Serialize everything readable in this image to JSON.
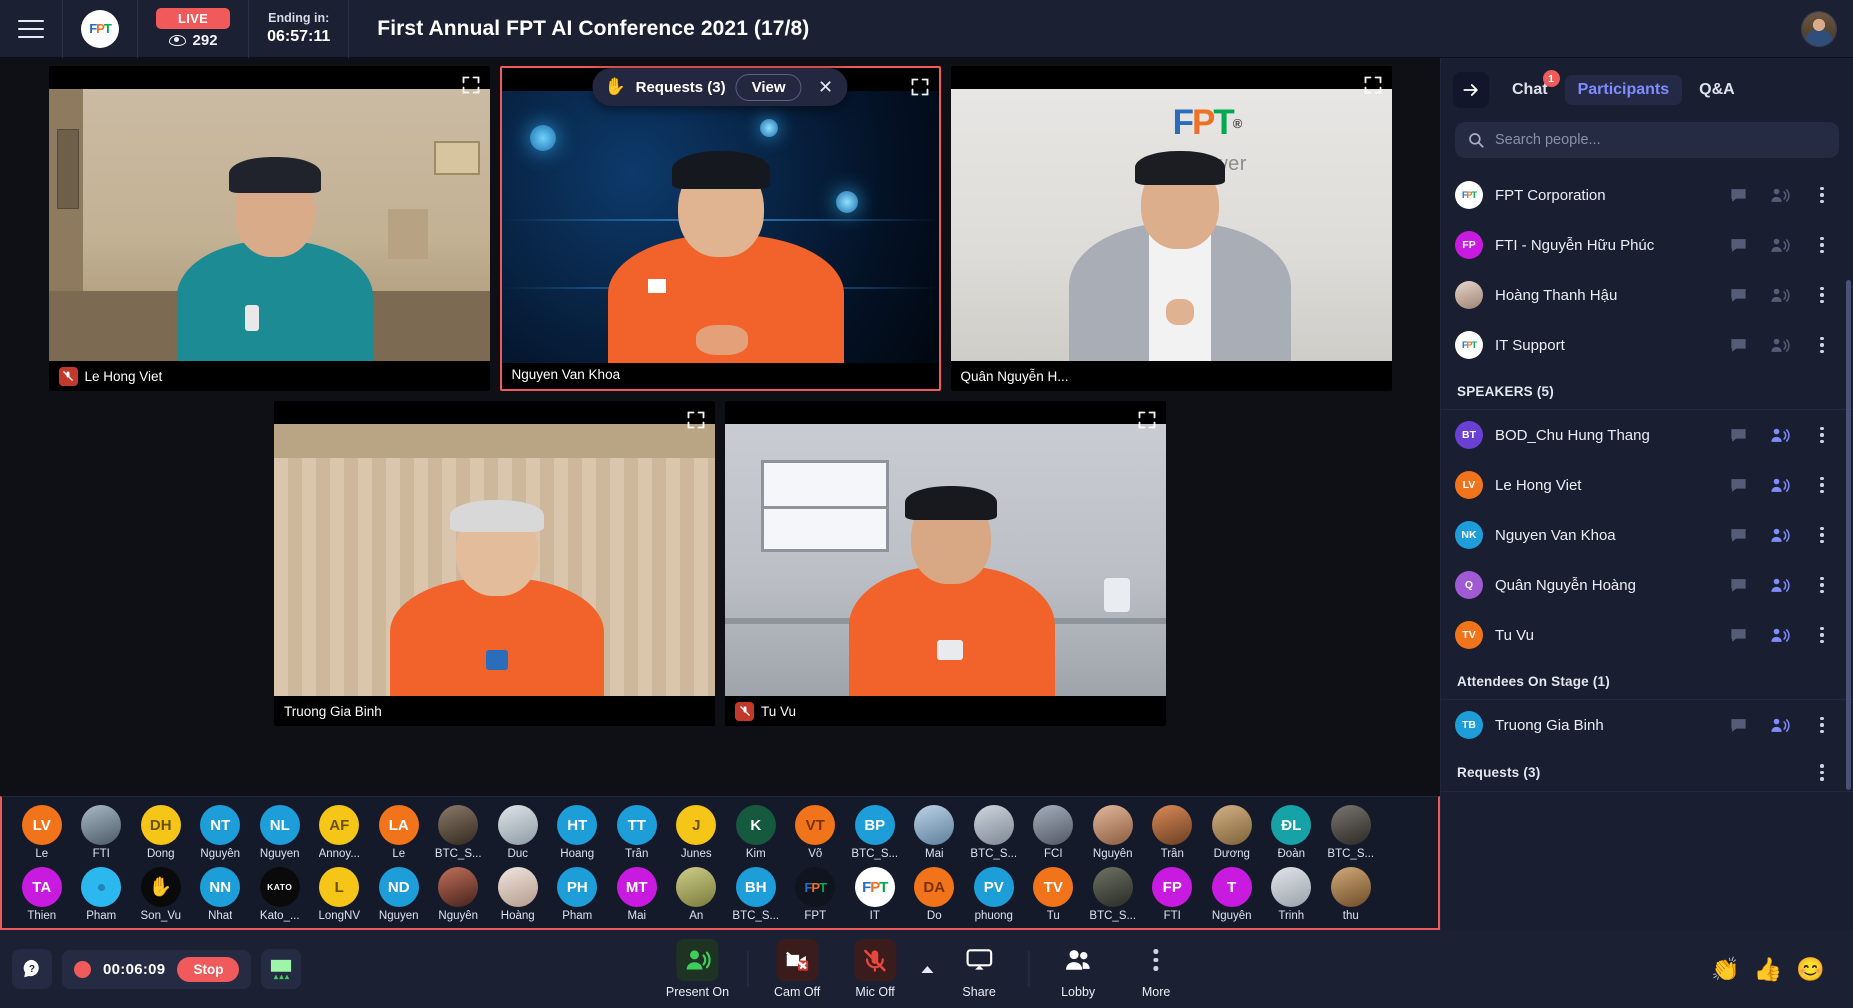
{
  "topbar": {
    "menu_icon": "hamburger-icon",
    "brand": "FPT",
    "live_label": "LIVE",
    "viewer_count": "292",
    "ending_label": "Ending in:",
    "ending_time": "06:57:11",
    "title": "First Annual FPT AI Conference 2021 (17/8)"
  },
  "requests_banner": {
    "hand_icon": "raised-hand-icon",
    "label": "Requests (3)",
    "view_label": "View",
    "close_label": "✕"
  },
  "tiles": [
    {
      "name": "Le Hong Viet",
      "muted": true,
      "bg": "office-teal"
    },
    {
      "name": "Nguyen Van Khoa",
      "muted": false,
      "bg": "tech-blue",
      "active": true
    },
    {
      "name": "Quân Nguyễn H...",
      "muted": false,
      "bg": "fpt-tower"
    },
    {
      "name": "Truong Gia Binh",
      "muted": false,
      "bg": "curtain-room"
    },
    {
      "name": "Tu Vu",
      "muted": true,
      "bg": "window-office"
    }
  ],
  "strip_row1": [
    {
      "initials": "LV",
      "name": "Le",
      "color": "#f2741a",
      "photo": false
    },
    {
      "initials": "",
      "name": "FTI",
      "color": "#5b7a94",
      "photo": true,
      "ph": "f1"
    },
    {
      "initials": "DH",
      "name": "Dong",
      "color": "#f5c518",
      "photo": false,
      "dark": true
    },
    {
      "initials": "NT",
      "name": "Nguyễn",
      "color": "#1e9ed9",
      "photo": false
    },
    {
      "initials": "NL",
      "name": "Nguyen",
      "color": "#1e9ed9",
      "photo": false
    },
    {
      "initials": "AF",
      "name": "Annoy...",
      "color": "#f5c518",
      "photo": false,
      "dark": true
    },
    {
      "initials": "LA",
      "name": "Le",
      "color": "#f2741a",
      "photo": false
    },
    {
      "initials": "",
      "name": "BTC_S...",
      "color": "#6b5a4a",
      "photo": true,
      "ph": "f2"
    },
    {
      "initials": "",
      "name": "Duc",
      "color": "#b9c3cc",
      "photo": true,
      "ph": "f3"
    },
    {
      "initials": "HT",
      "name": "Hoang",
      "color": "#1e9ed9",
      "photo": false
    },
    {
      "initials": "TT",
      "name": "Trần",
      "color": "#1e9ed9",
      "photo": false
    },
    {
      "initials": "J",
      "name": "Junes",
      "color": "#f5c518",
      "photo": false,
      "dark": true
    },
    {
      "initials": "K",
      "name": "Kim",
      "color": "#15593f",
      "photo": false
    },
    {
      "initials": "VT",
      "name": "Võ",
      "color": "#f2741a",
      "photo": false,
      "dark": true
    },
    {
      "initials": "BP",
      "name": "BTC_S...",
      "color": "#1e9ed9",
      "photo": false
    },
    {
      "initials": "",
      "name": "Mai",
      "color": "#88a7c2",
      "photo": true,
      "ph": "f4"
    },
    {
      "initials": "",
      "name": "BTC_S...",
      "color": "#9aa5b5",
      "photo": true,
      "ph": "f5"
    },
    {
      "initials": "",
      "name": "FCI",
      "color": "#8d98a8",
      "photo": true,
      "ph": "f6"
    },
    {
      "initials": "",
      "name": "Nguyễn",
      "color": "#c59a7a",
      "photo": true,
      "ph": "f7"
    },
    {
      "initials": "",
      "name": "Trần",
      "color": "#c4734a",
      "photo": true,
      "ph": "f8"
    },
    {
      "initials": "",
      "name": "Dương",
      "color": "#b8864f",
      "photo": true,
      "ph": "f9"
    },
    {
      "initials": "ĐL",
      "name": "Đoàn",
      "color": "#17a2a8",
      "photo": false
    },
    {
      "initials": "",
      "name": "BTC_S...",
      "color": "#6e6a66",
      "photo": true,
      "ph": "f10"
    }
  ],
  "strip_row2": [
    {
      "initials": "TA",
      "name": "Thien",
      "color": "#c91ae0",
      "photo": false
    },
    {
      "initials": "",
      "name": "Pham",
      "color": "#2bb8ef",
      "photo": false,
      "blank": true
    },
    {
      "initials": "✋",
      "name": "Son_Vu",
      "color": "#0a0a0a",
      "photo": false,
      "emoji": true
    },
    {
      "initials": "NN",
      "name": "Nhat",
      "color": "#1e9ed9",
      "photo": false
    },
    {
      "initials": "KATO",
      "name": "Kato_...",
      "color": "#0a0a0a",
      "photo": false,
      "tiny": true
    },
    {
      "initials": "L",
      "name": "LongNV",
      "color": "#f5c518",
      "photo": false,
      "dark": true
    },
    {
      "initials": "ND",
      "name": "Nguyen",
      "color": "#1e9ed9",
      "photo": false
    },
    {
      "initials": "",
      "name": "Nguyễn",
      "color": "#8a4a3a",
      "photo": true,
      "ph": "f11"
    },
    {
      "initials": "",
      "name": "Hoàng",
      "color": "#e0d7d2",
      "photo": true,
      "ph": "f12"
    },
    {
      "initials": "PH",
      "name": "Pham",
      "color": "#1e9ed9",
      "photo": false
    },
    {
      "initials": "MT",
      "name": "Mai",
      "color": "#c91ae0",
      "photo": false
    },
    {
      "initials": "",
      "name": "An",
      "color": "#b3b36a",
      "photo": true,
      "ph": "f13"
    },
    {
      "initials": "BH",
      "name": "BTC_S...",
      "color": "#1e9ed9",
      "photo": false
    },
    {
      "initials": "FPT",
      "name": "FPT",
      "color": "#111522",
      "photo": false,
      "logo": true
    },
    {
      "initials": "FPT",
      "name": "IT",
      "color": "#ffffff",
      "photo": false,
      "logo2": true
    },
    {
      "initials": "DA",
      "name": "Do",
      "color": "#f2741a",
      "photo": false,
      "dark": true
    },
    {
      "initials": "PV",
      "name": "phuong",
      "color": "#1e9ed9",
      "photo": false
    },
    {
      "initials": "TV",
      "name": "Tu",
      "color": "#f2741a",
      "photo": false
    },
    {
      "initials": "",
      "name": "BTC_S...",
      "color": "#5a5f52",
      "photo": true,
      "ph": "f14"
    },
    {
      "initials": "FP",
      "name": "FTI",
      "color": "#c91ae0",
      "photo": false
    },
    {
      "initials": "T",
      "name": "Nguyễn",
      "color": "#c91ae0",
      "photo": false
    },
    {
      "initials": "",
      "name": "Trinh",
      "color": "#d5d8dd",
      "photo": true,
      "ph": "f15"
    },
    {
      "initials": "",
      "name": "thu",
      "color": "#b08d5c",
      "photo": true,
      "ph": "f16"
    }
  ],
  "controls": {
    "help_icon": "help-bubble-icon",
    "rec_time": "00:06:09",
    "stop_label": "Stop",
    "board_icon": "whiteboard-icon",
    "items": [
      {
        "label": "Present On",
        "icon": "present-on-icon",
        "state": "green"
      },
      {
        "label": "Cam Off",
        "icon": "camera-off-icon",
        "state": "red"
      },
      {
        "label": "Mic Off",
        "icon": "mic-off-icon",
        "state": "red"
      },
      {
        "label": "Share",
        "icon": "share-screen-icon",
        "state": "plain"
      },
      {
        "label": "Lobby",
        "icon": "people-icon",
        "state": "plain"
      },
      {
        "label": "More",
        "icon": "more-dots-icon",
        "state": "plain"
      }
    ],
    "reactions": [
      "👏",
      "👍",
      "😊"
    ]
  },
  "sidebar": {
    "collapse_icon": "arrow-right-icon",
    "tabs": [
      {
        "label": "Chat",
        "active": false,
        "badge": "1"
      },
      {
        "label": "Participants",
        "active": true,
        "badge": ""
      },
      {
        "label": "Q&A",
        "active": false,
        "badge": ""
      }
    ],
    "search_placeholder": "Search people...",
    "top_list": [
      {
        "initials": "FPT",
        "name": "FPT Corporation",
        "color": "#ffffff",
        "speaking": false,
        "logo": true
      },
      {
        "initials": "FP",
        "name": "FTI - Nguyễn Hữu Phúc",
        "color": "#c91ae0",
        "speaking": false
      },
      {
        "initials": "",
        "name": "Hoàng Thanh Hậu",
        "color": "#d8c6bb",
        "speaking": false,
        "photo": true
      },
      {
        "initials": "FPT",
        "name": "IT Support",
        "color": "#ffffff",
        "speaking": false,
        "logo": true
      }
    ],
    "speakers_header": "SPEAKERS (5)",
    "speakers": [
      {
        "initials": "BT",
        "name": "BOD_Chu Hung Thang",
        "color": "#6a3fd4",
        "speaking": true
      },
      {
        "initials": "LV",
        "name": "Le Hong Viet",
        "color": "#f2741a",
        "speaking": true
      },
      {
        "initials": "NK",
        "name": "Nguyen Van Khoa",
        "color": "#1e9ed9",
        "speaking": true
      },
      {
        "initials": "Q",
        "name": "Quân Nguyễn Hoàng",
        "color": "#a05bd4",
        "speaking": true
      },
      {
        "initials": "TV",
        "name": "Tu Vu",
        "color": "#f2741a",
        "speaking": true
      }
    ],
    "onstage_header": "Attendees On Stage (1)",
    "onstage": [
      {
        "initials": "TB",
        "name": "Truong Gia Binh",
        "color": "#1e9ed9",
        "speaking": true
      }
    ],
    "requests_header": "Requests (3)"
  }
}
